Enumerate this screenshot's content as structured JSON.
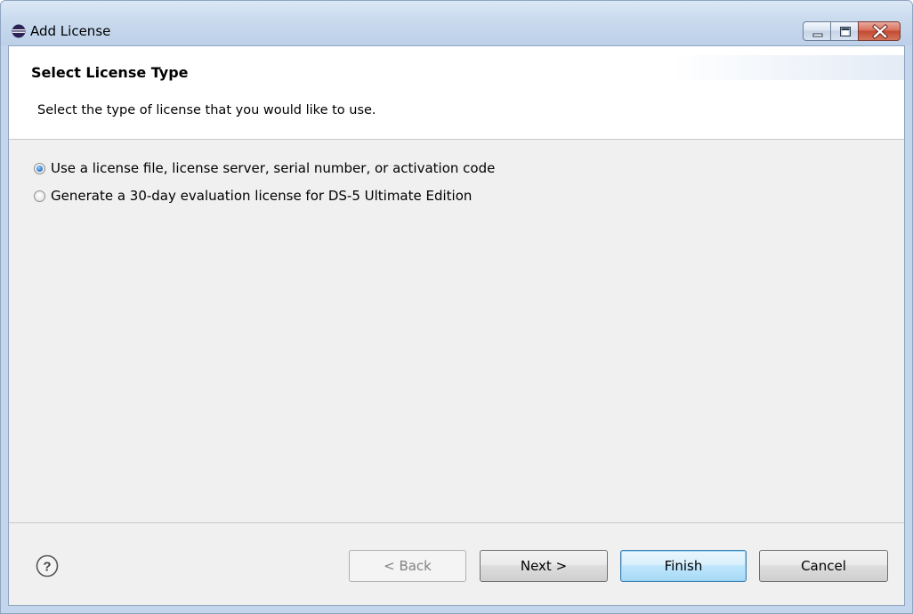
{
  "window": {
    "title": "Add License"
  },
  "header": {
    "title": "Select License Type",
    "description": "Select the type of license that you would like to use."
  },
  "options": [
    {
      "label": "Use a license file, license server, serial number, or activation code",
      "selected": true
    },
    {
      "label": "Generate a 30-day evaluation license for DS-5 Ultimate Edition",
      "selected": false
    }
  ],
  "buttons": {
    "back": "< Back",
    "next": "Next >",
    "finish": "Finish",
    "cancel": "Cancel"
  },
  "icons": {
    "app": "eclipse-icon",
    "help": "help-icon",
    "minimize": "minimize-icon",
    "maximize": "maximize-icon",
    "close": "close-icon"
  },
  "colors": {
    "titlebar": "#c9daee",
    "client_background": "#f0f0f0",
    "header_background": "#ffffff",
    "close_button": "#c24a32",
    "default_button": "#bee6fd",
    "radio_selected": "#3a86d6"
  }
}
